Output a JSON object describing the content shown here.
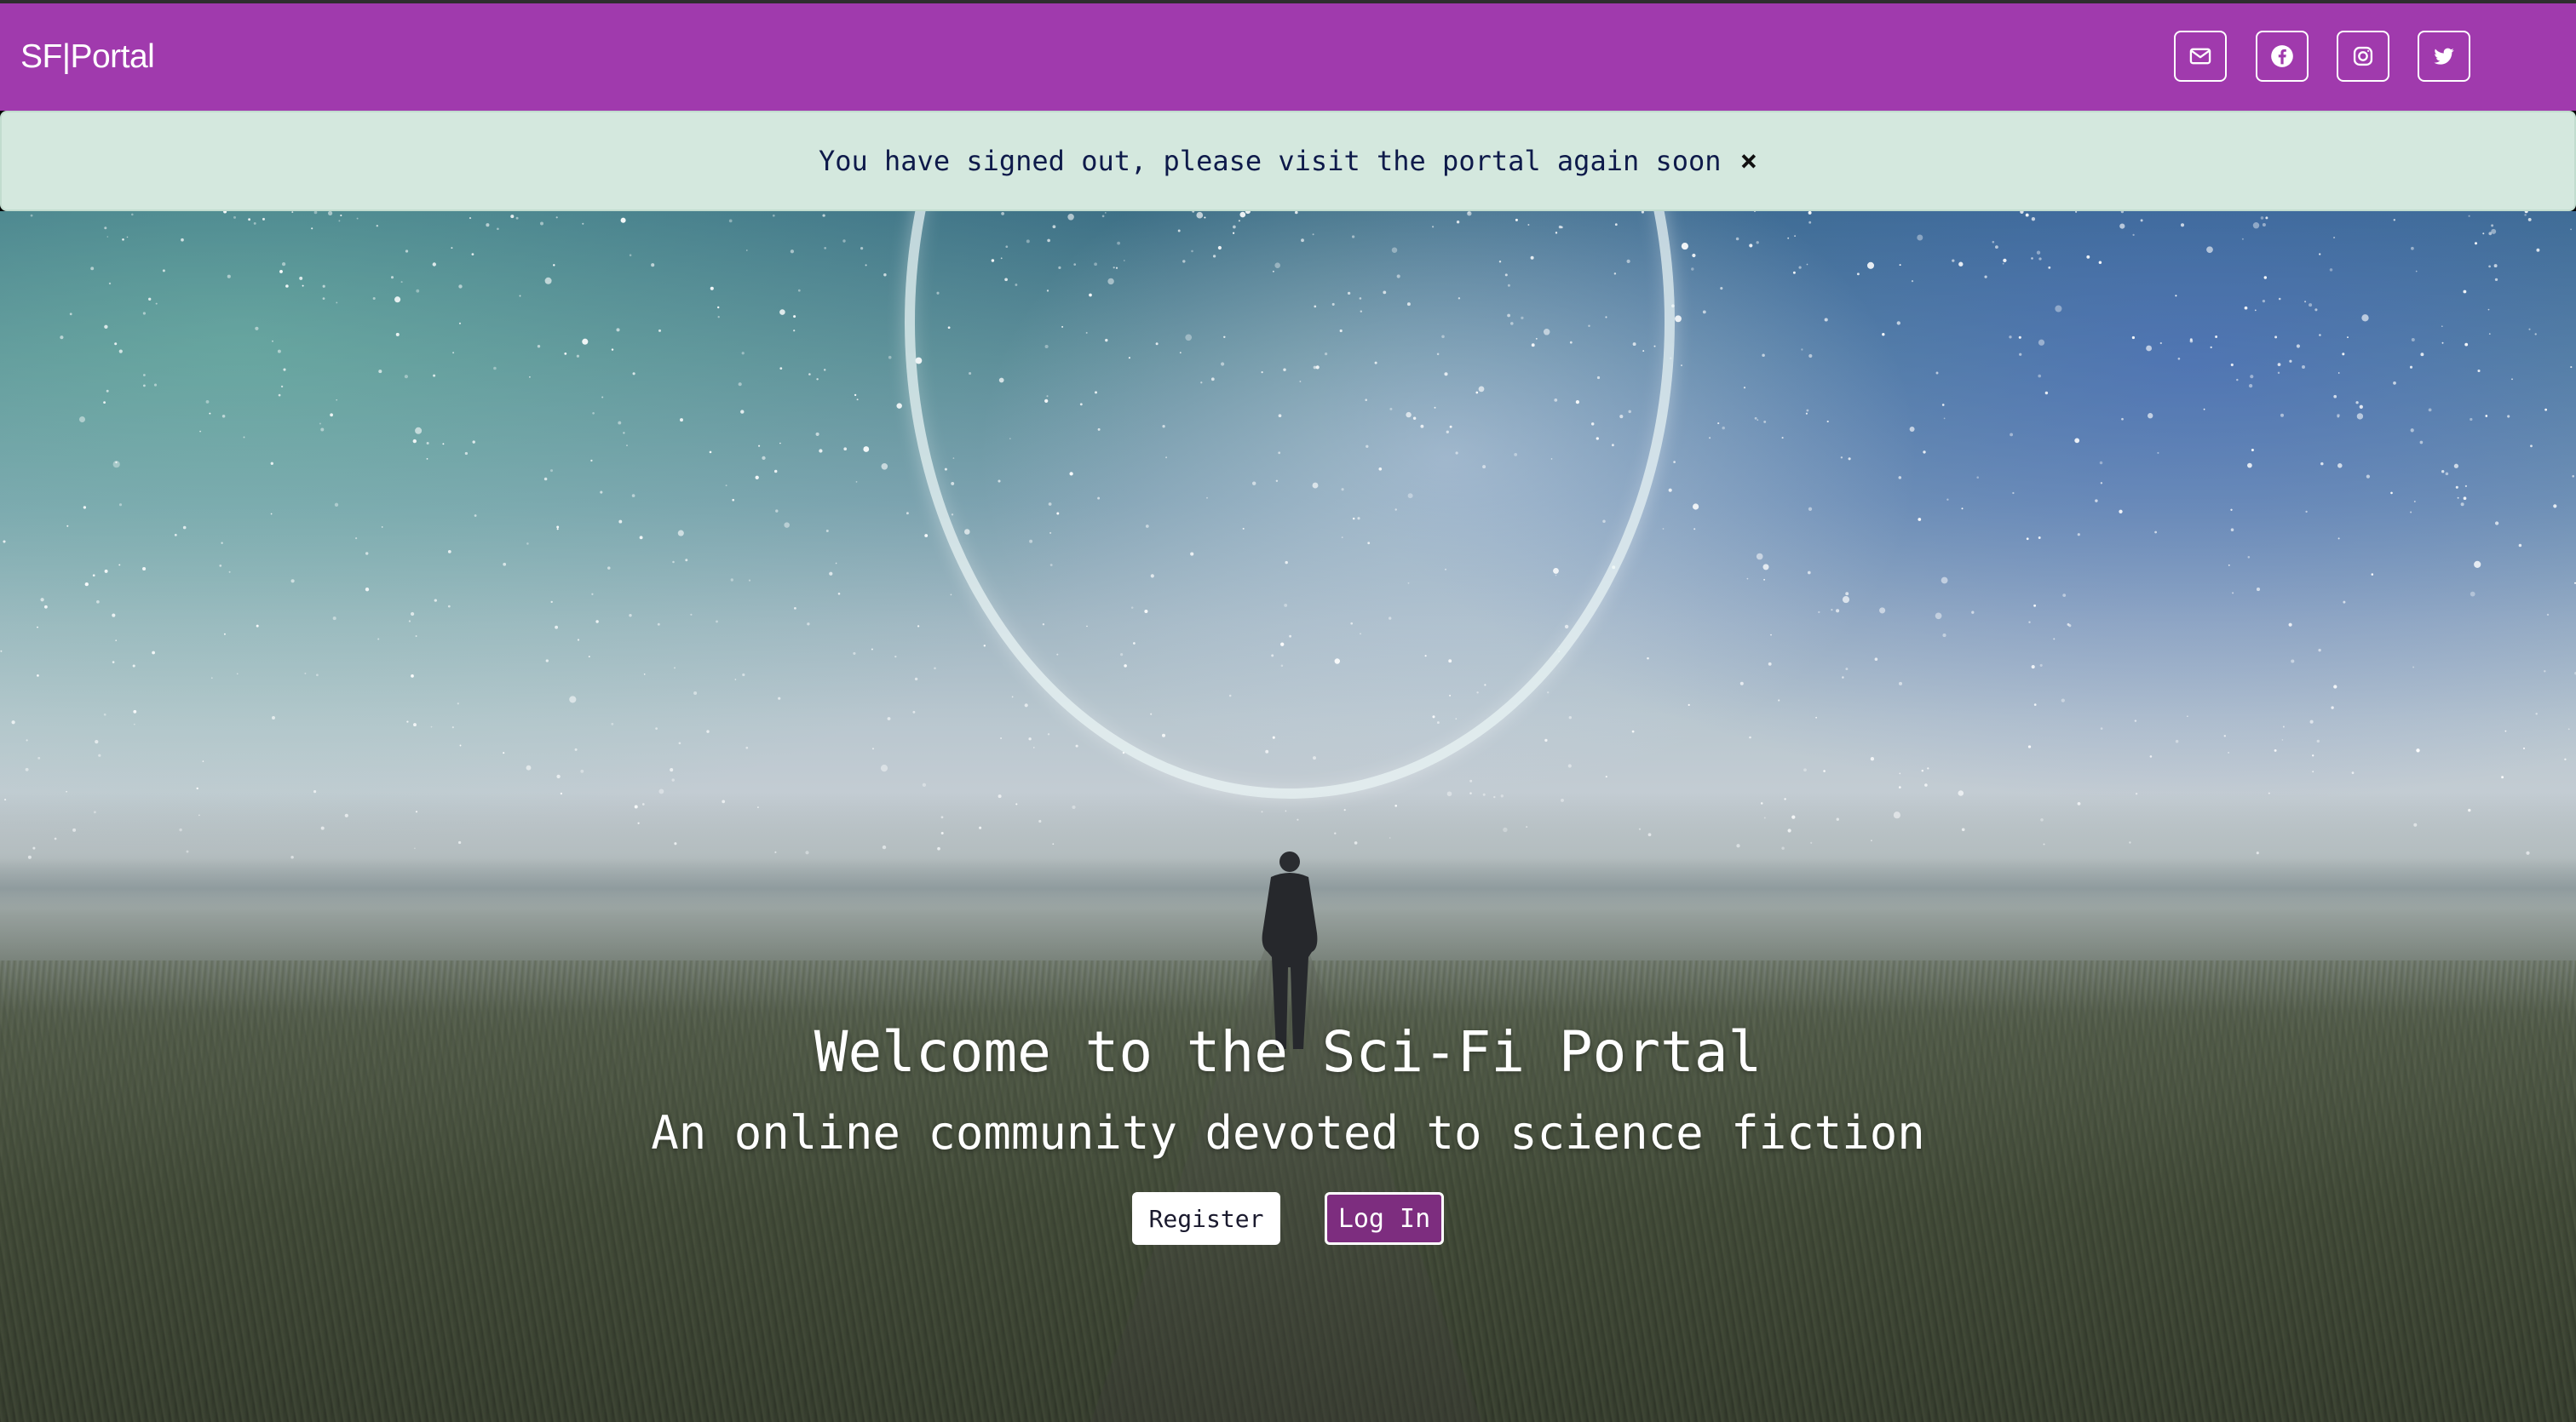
{
  "navbar": {
    "brand": "SF|Portal",
    "background": "#a03aad",
    "social": [
      {
        "name": "mail-icon"
      },
      {
        "name": "facebook-icon"
      },
      {
        "name": "instagram-icon"
      },
      {
        "name": "twitter-icon"
      }
    ]
  },
  "alert": {
    "message": "You have signed out, please visit the portal again soon",
    "close_label": "×",
    "background": "#d4e8de"
  },
  "hero": {
    "title": "Welcome to the Sci-Fi Portal",
    "subtitle": "An online community devoted to science fiction",
    "register_label": "Register",
    "login_label": "Log In",
    "login_color": "#7d2d7f"
  }
}
